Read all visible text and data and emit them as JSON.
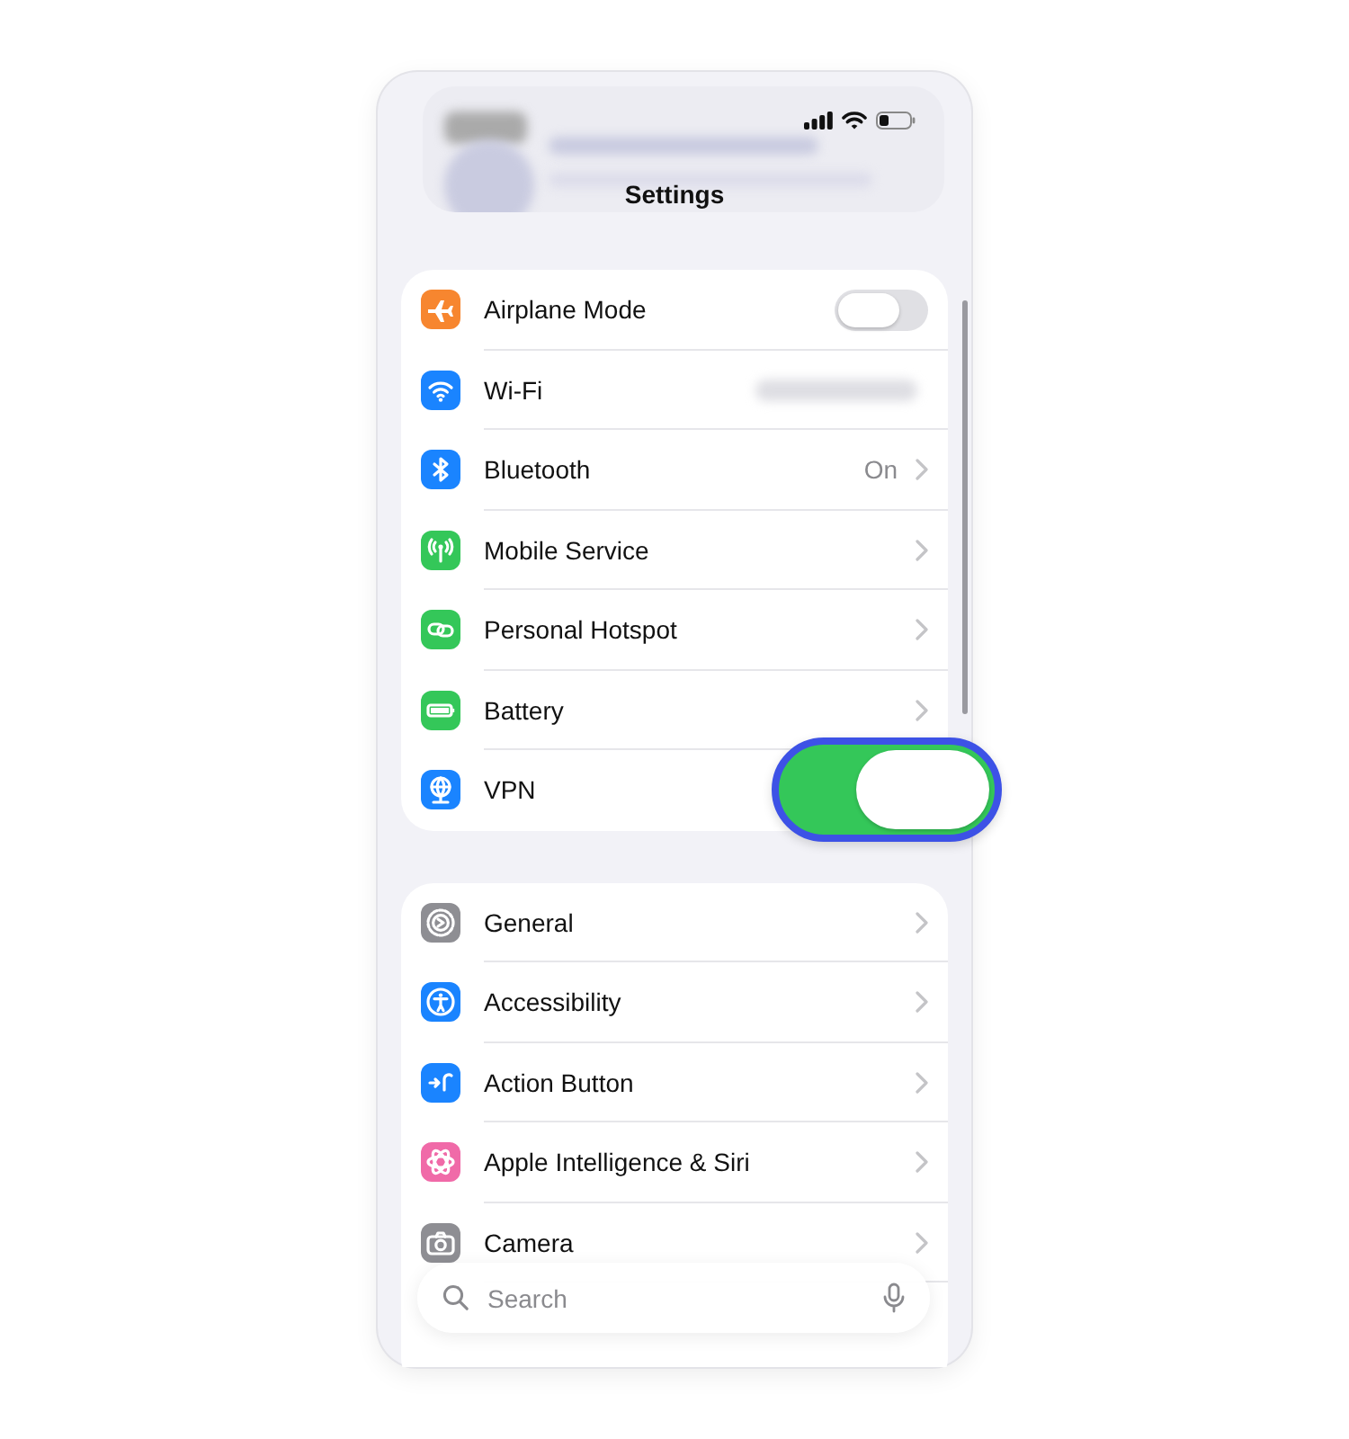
{
  "title": "Settings",
  "groups": [
    {
      "rows": [
        {
          "label": "Airplane Mode",
          "kind": "toggle",
          "on": false,
          "highlighted": false,
          "color": "#f7862f"
        },
        {
          "label": "Wi-Fi",
          "kind": "hidden_value",
          "color": "#1a84ff"
        },
        {
          "label": "Bluetooth",
          "kind": "value",
          "value": "On",
          "color": "#1a84ff"
        },
        {
          "label": "Mobile Service",
          "kind": "link",
          "color": "#34c759"
        },
        {
          "label": "Personal Hotspot",
          "kind": "link",
          "color": "#34c759"
        },
        {
          "label": "Battery",
          "kind": "link",
          "color": "#34c759"
        },
        {
          "label": "VPN",
          "kind": "toggle",
          "on": true,
          "highlighted": true,
          "color": "#1a84ff"
        }
      ]
    },
    {
      "rows": [
        {
          "label": "General",
          "kind": "link",
          "color": "#8e8e93"
        },
        {
          "label": "Accessibility",
          "kind": "link",
          "color": "#1a84ff"
        },
        {
          "label": "Action Button",
          "kind": "link",
          "color": "#1a84ff"
        },
        {
          "label": "Apple Intelligence & Siri",
          "kind": "link",
          "color": "#f06aa8"
        },
        {
          "label": "Camera",
          "kind": "link",
          "color": "#8e8e93"
        }
      ]
    }
  ],
  "search": {
    "placeholder": "Search"
  }
}
